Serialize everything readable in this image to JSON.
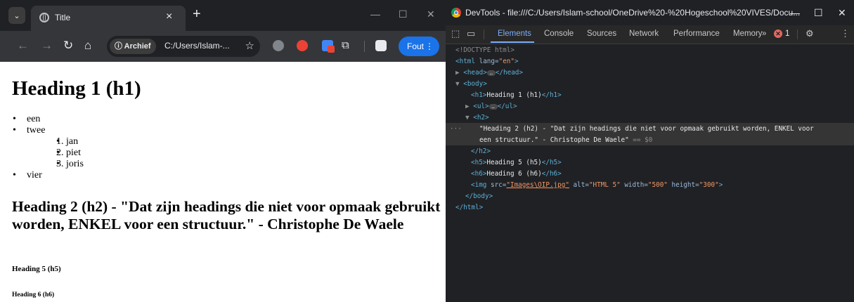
{
  "browser": {
    "tab_title": "Title",
    "url_chip": "ⓘ Archief",
    "url": "C:/Users/Islam-...",
    "profile_button": "Fout"
  },
  "page": {
    "h1": "Heading 1 (h1)",
    "list": [
      "een",
      "twee",
      "vier"
    ],
    "sublist": [
      "1. jan",
      "2. piet",
      "3. joris"
    ],
    "h2": "Heading 2 (h2) - \"Dat zijn headings die niet voor opmaak gebruikt worden, ENKEL voor een structuur.\" - Christophe De Waele",
    "h5": "Heading 5 (h5)",
    "h6": "Heading 6 (h6)"
  },
  "devtools": {
    "title": "DevTools - file:///C:/Users/Islam-school/OneDrive%20-%20Hogeschool%20VIVES/Docu...",
    "tabs": [
      "Elements",
      "Console",
      "Sources",
      "Network",
      "Performance",
      "Memory"
    ],
    "active_tab": "Elements",
    "more_tabs": "»",
    "error_count": "1",
    "dom": {
      "doctype": "<!DOCTYPE html>",
      "html_open_tag": "<html",
      "lang_attr": " lang=",
      "lang_value": "\"en\"",
      "gt": ">",
      "head_open": "<head>",
      "head_close": "</head>",
      "body_open": "<body>",
      "h1_open": "<h1>",
      "h1_text": "Heading 1 (h1)",
      "h1_close": "</h1>",
      "ul_open": "<ul>",
      "ul_close": "</ul>",
      "h2_open": "<h2>",
      "h2_text_1": "\"Heading 2 (h2) - \"Dat zijn headings die niet voor opmaak gebruikt worden, ENKEL voor",
      "h2_text_2": "een structuur.\" - Christophe De Waele\"",
      "h2_eq": " == $0",
      "h2_close": "</h2>",
      "h5_open": "<h5>",
      "h5_text": "Heading 5 (h5)",
      "h5_close": "</h5>",
      "h6_open": "<h6>",
      "h6_text": "Heading 6 (h6)",
      "h6_close": "</h6>",
      "img_open": "<img",
      "src_attr": " src=",
      "src_value": "\"Images\\OIP.jpg\"",
      "alt_attr": " alt=",
      "alt_value": "\"HTML 5\"",
      "width_attr": " width=",
      "width_value": "\"500\"",
      "height_attr": " height=",
      "height_value": "\"300\"",
      "body_close": "</body>",
      "html_close": "</html>"
    }
  }
}
